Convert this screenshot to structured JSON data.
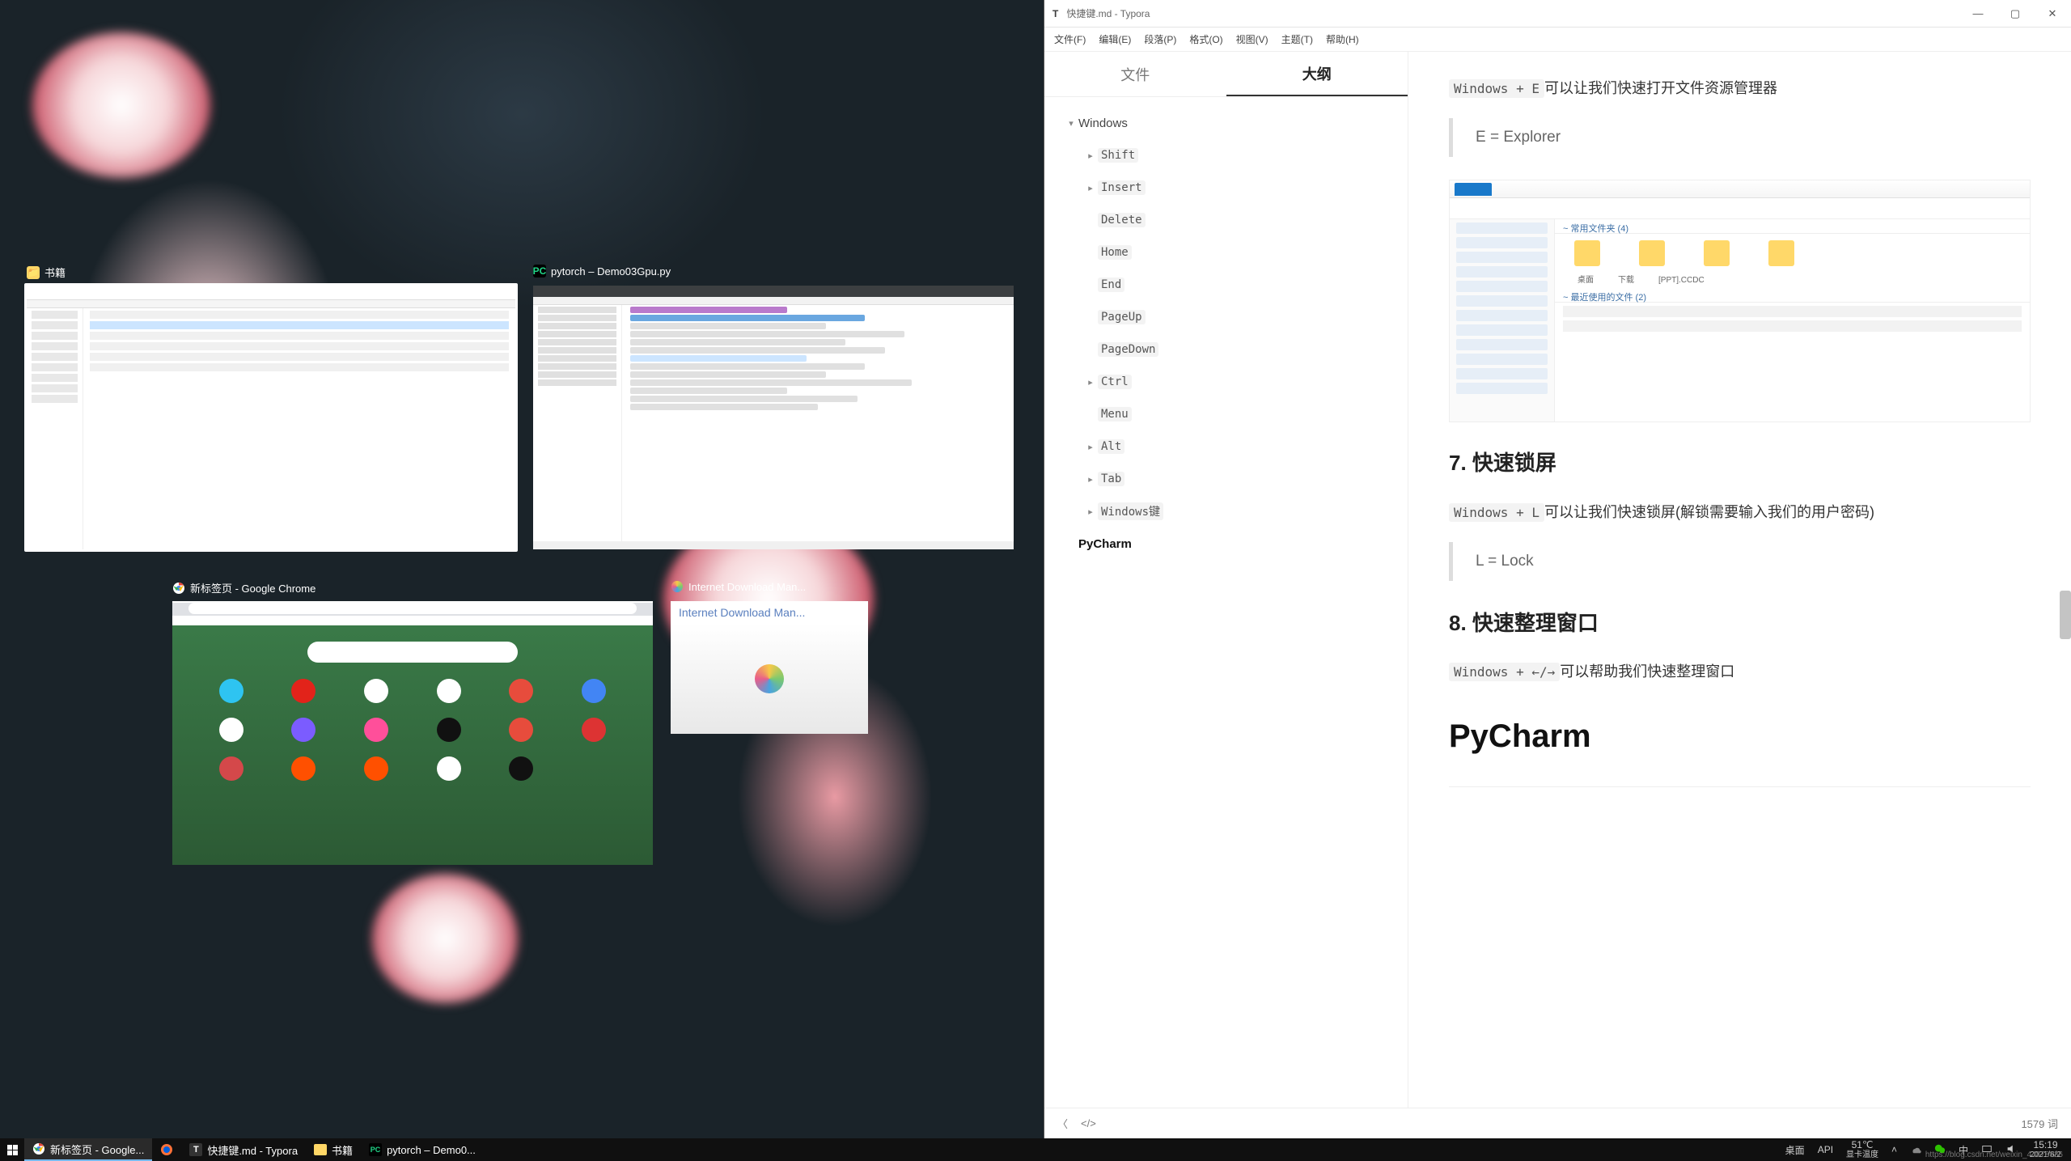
{
  "taskview": {
    "thumb1": {
      "title": "书籍",
      "icon_bg": "#ffd766"
    },
    "thumb2": {
      "title": "pytorch – Demo03Gpu.py",
      "icon_bg": "#21d789"
    },
    "thumb3": {
      "title": "新标签页 - Google Chrome"
    },
    "thumb4": {
      "title": "Internet Download Man...",
      "inner_title": "Internet Download Man..."
    }
  },
  "typora": {
    "title": "快捷键.md - Typora",
    "menus": [
      "文件(F)",
      "编辑(E)",
      "段落(P)",
      "格式(O)",
      "视图(V)",
      "主题(T)",
      "帮助(H)"
    ],
    "tabs": {
      "file": "文件",
      "outline": "大纲"
    },
    "outline": {
      "root": "Windows",
      "items": [
        "Shift",
        "Insert",
        "Delete",
        "Home",
        "End",
        "PageUp",
        "PageDown",
        "Ctrl",
        "Menu",
        "Alt",
        "Tab",
        "Windows键"
      ],
      "expandable": [
        true,
        true,
        false,
        false,
        false,
        false,
        false,
        true,
        false,
        true,
        true,
        true
      ],
      "last": "PyCharm"
    },
    "content": {
      "line1_pre": "Windows + E",
      "line1_post": "可以让我们快速打开文件资源管理器",
      "quote1": "E = Explorer",
      "shot_hdr1": "~ 常用文件夹 (4)",
      "shot_hdr2": "~ 最近使用的文件 (2)",
      "shot_lbl1": "桌面",
      "shot_lbl2": "下载",
      "shot_lbl3": "[PPT].CCDC",
      "h7": "7. 快速锁屏",
      "line2_pre": "Windows + L",
      "line2_post": "可以让我们快速锁屏(解锁需要输入我们的用户密码)",
      "quote2": "L = Lock",
      "h8": "8. 快速整理窗口",
      "line3_pre": "Windows + ←/→",
      "line3_post": "可以帮助我们快速整理窗口",
      "h1": "PyCharm"
    },
    "footer": {
      "back": "〈",
      "src": "</>",
      "words": "1579 词"
    }
  },
  "taskbar": {
    "items": [
      {
        "label": "新标签页 - Google...",
        "icon": "chrome"
      },
      {
        "label": "",
        "icon": "firefox"
      },
      {
        "label": "快捷键.md - Typora",
        "icon": "typora"
      },
      {
        "label": "书籍",
        "icon": "folder"
      },
      {
        "label": "pytorch – Demo0...",
        "icon": "pycharm"
      }
    ],
    "right": {
      "desktop": "桌面",
      "api": "API",
      "temp": "51℃",
      "temp_lbl": "显卡温度",
      "time": "15:19",
      "date": "2021/6/2",
      "watermark": "https://blog.csdn.net/weixin_44878336"
    }
  }
}
